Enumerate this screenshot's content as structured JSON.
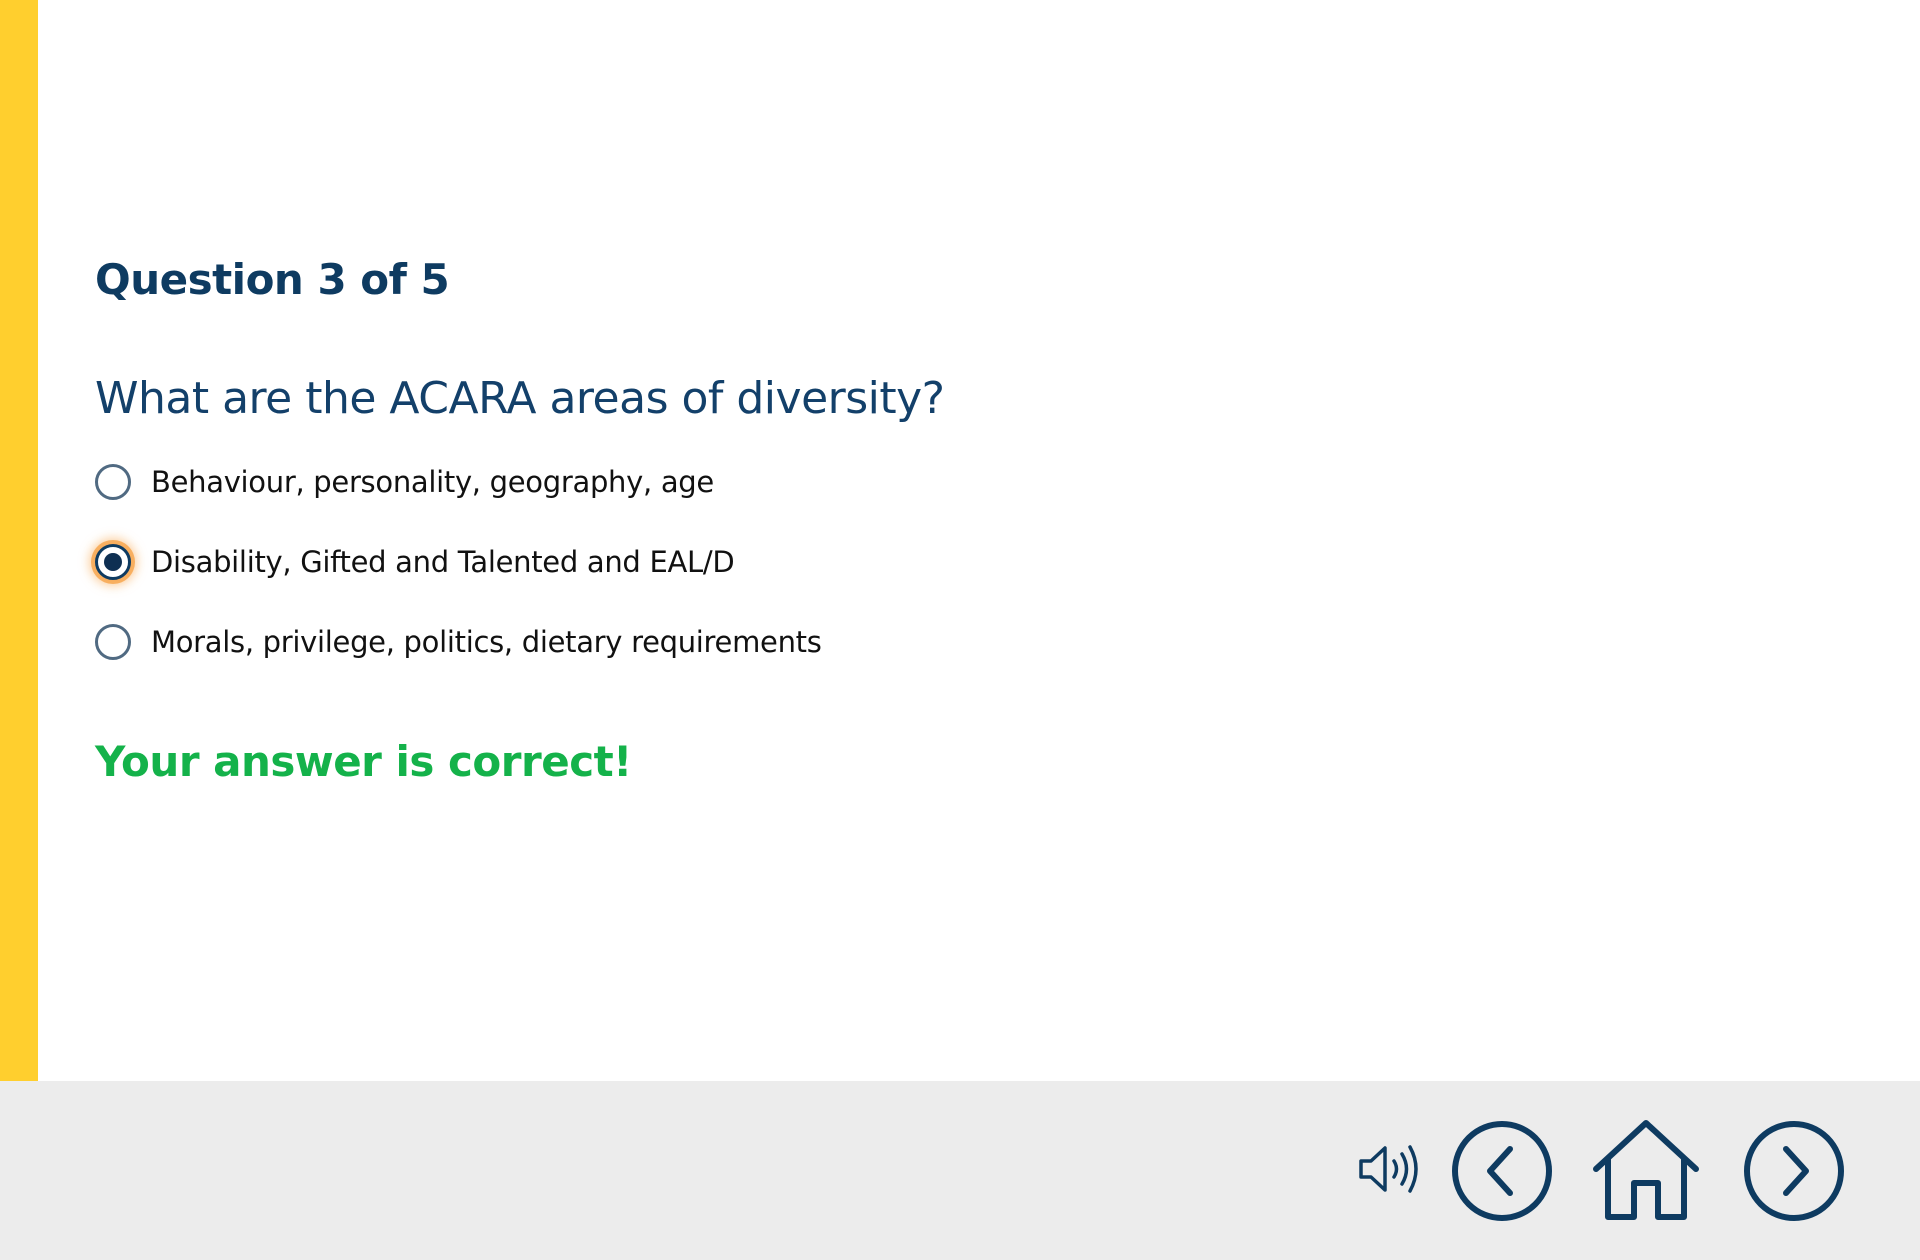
{
  "quiz": {
    "heading": "Question 3 of 5",
    "question": "What are the ACARA areas of diversity?",
    "options": [
      {
        "label": "Behaviour, personality, geography, age",
        "selected": false
      },
      {
        "label": "Disability, Gifted and Talented and EAL/D",
        "selected": true
      },
      {
        "label": "Morals, privilege, politics, dietary requirements",
        "selected": false
      }
    ],
    "feedback": "Your answer is correct!"
  },
  "footer": {
    "controls": [
      {
        "icon": "speaker-icon"
      },
      {
        "icon": "chevron-left-circle-icon"
      },
      {
        "icon": "home-icon"
      },
      {
        "icon": "chevron-right-circle-icon"
      }
    ]
  },
  "colors": {
    "accent_bar": "#ffcf2e",
    "primary_navy": "#0e3b61",
    "correct_green": "#14b24a",
    "footer_bg": "#ececec",
    "focus_glow": "#f7a750"
  }
}
